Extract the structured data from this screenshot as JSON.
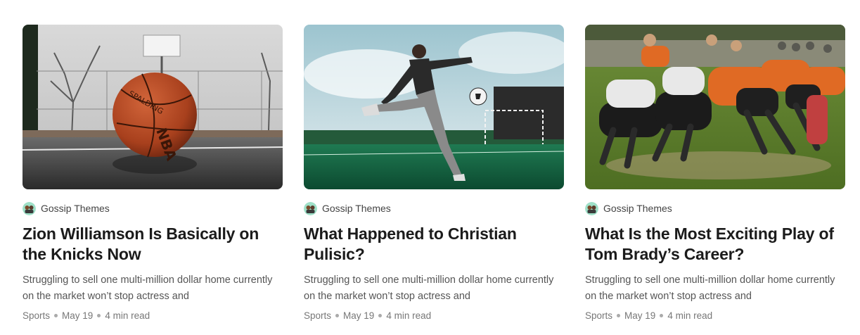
{
  "cards": [
    {
      "image": "basketball-court-photo",
      "author": "Gossip Themes",
      "title": "Zion Williamson Is Basically on the Knicks Now",
      "excerpt": "Struggling to sell one multi-million dollar home currently on the market won’t stop actress and",
      "category": "Sports",
      "date": "May 19",
      "read_time": "4 min read"
    },
    {
      "image": "soccer-kick-photo",
      "author": "Gossip Themes",
      "title": "What Happened to Christian Pulisic?",
      "excerpt": "Struggling to sell one multi-million dollar home currently on the market won’t stop actress and",
      "category": "Sports",
      "date": "May 19",
      "read_time": "4 min read"
    },
    {
      "image": "rugby-scrum-photo",
      "author": "Gossip Themes",
      "title": "What Is the Most Exciting Play of Tom Brady’s Career?",
      "excerpt": "Struggling to sell one multi-million dollar home currently on the market won’t stop actress and",
      "category": "Sports",
      "date": "May 19",
      "read_time": "4 min read"
    }
  ]
}
